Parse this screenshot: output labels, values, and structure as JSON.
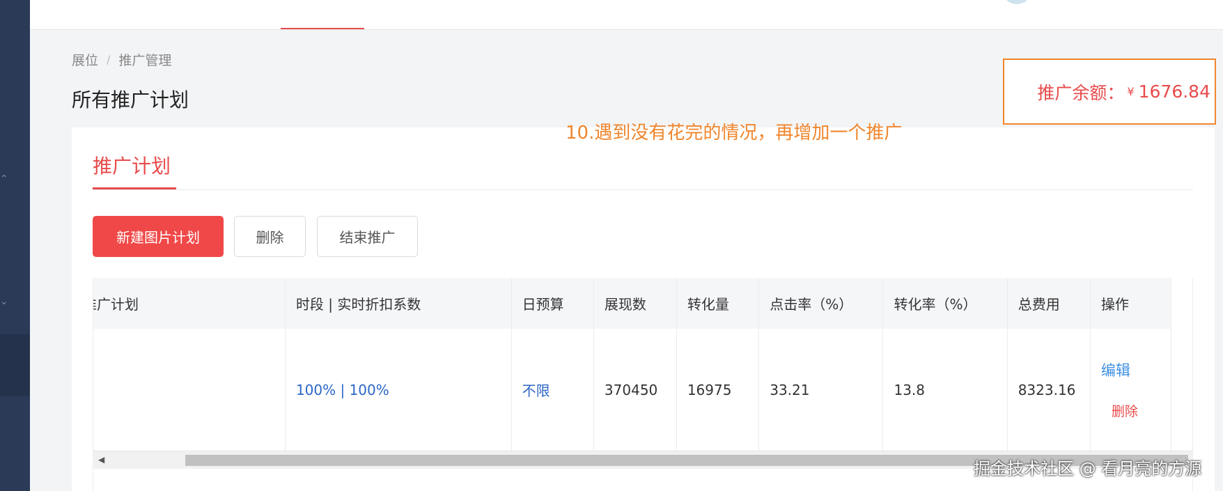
{
  "breadcrumb": {
    "root": "展位",
    "separator": "/",
    "current": "推广管理"
  },
  "page_title": "所有推广计划",
  "balance": {
    "label": "推广余额：",
    "currency": "¥",
    "amount": "1676.84"
  },
  "annotation": "10.遇到没有花完的情况，再增加一个推广",
  "card": {
    "tab": "推广计划",
    "buttons": {
      "create": "新建图片计划",
      "delete": "删除",
      "end": "结束推广"
    }
  },
  "table": {
    "headers": [
      "推广计划",
      "时段 | 实时折扣系数",
      "日预算",
      "展现数",
      "转化量",
      "点击率（%）",
      "转化率（%）",
      "总费用",
      "操作"
    ],
    "rows": [
      {
        "plan": "",
        "period": "100% | 100%",
        "budget": "不限",
        "impressions": "370450",
        "conversions": "16975",
        "ctr": "33.21",
        "cvr": "13.8",
        "cost": "8323.16",
        "edit": "编辑",
        "delete": "删除"
      }
    ]
  },
  "watermark": "掘金技术社区 @ 看月亮的方源",
  "colors": {
    "accent": "#e84b4b",
    "annotation": "#f0862d",
    "link": "#2b66c6",
    "sidebar": "#2b3b57"
  },
  "icons": {
    "sidebar_expand": "chevron-up-icon",
    "sidebar_collapse": "chevron-down-icon",
    "scroll_left": "triangle-left-icon"
  }
}
